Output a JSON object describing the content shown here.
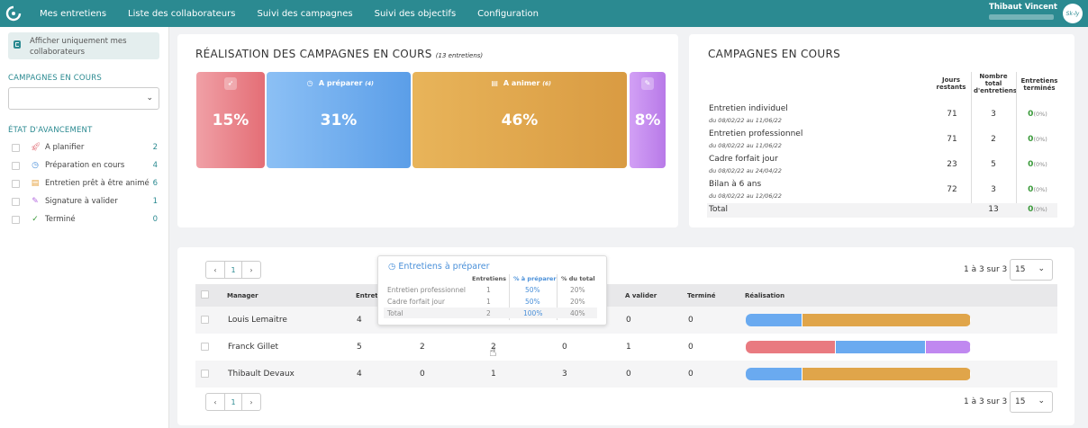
{
  "nav": {
    "items": [
      "Mes entretiens",
      "Liste des collaborateurs",
      "Suivi des campagnes",
      "Suivi des objectifs",
      "Configuration"
    ],
    "user_name": "Thibaut Vincent",
    "avatar_text": "Sk-ly"
  },
  "sidebar": {
    "toggle_label": "Afficher uniquement mes collaborateurs",
    "campaigns_title": "CAMPAGNES EN COURS",
    "progress_title": "ÉTAT D'AVANCEMENT",
    "statuses": [
      {
        "label": "A planifier",
        "count": "2",
        "icon": "rocket-icon",
        "color": "#e06b74"
      },
      {
        "label": "Préparation en cours",
        "count": "4",
        "icon": "clock-icon",
        "color": "#4a90d9"
      },
      {
        "label": "Entretien prêt à être animé",
        "count": "6",
        "icon": "document-icon",
        "color": "#e6a23c"
      },
      {
        "label": "Signature à valider",
        "count": "1",
        "icon": "edit-icon",
        "color": "#b56be0"
      },
      {
        "label": "Terminé",
        "count": "0",
        "icon": "check-icon",
        "color": "#3a9a3a"
      }
    ]
  },
  "realisation": {
    "title": "RÉALISATION DES CAMPAGNES EN COURS",
    "subtitle": "(13 entretiens)",
    "segments": [
      {
        "pct": "15%",
        "label": "",
        "badge": "",
        "icon": "rocket-icon",
        "color": "#e97a80",
        "fraction": 0.15
      },
      {
        "pct": "31%",
        "label": "A préparer",
        "badge": "(4)",
        "icon": "clock-icon",
        "color": "#6aaaf0",
        "fraction": 0.31
      },
      {
        "pct": "46%",
        "label": "A animer",
        "badge": "(6)",
        "icon": "document-icon",
        "color": "#e0a54a",
        "fraction": 0.46
      },
      {
        "pct": "8%",
        "label": "",
        "badge": "",
        "icon": "edit-icon",
        "color": "#c088f0",
        "fraction": 0.08
      }
    ]
  },
  "campaigns": {
    "title": "CAMPAGNES EN COURS",
    "headers": {
      "days": "Jours restants",
      "total": "Nombre total d'entretiens",
      "done": "Entretiens terminés"
    },
    "rows": [
      {
        "name": "Entretien individuel",
        "dates": "du 08/02/22 au 11/06/22",
        "days": "71",
        "total": "3",
        "done": "0",
        "done_pct": "(0%)"
      },
      {
        "name": "Entretien professionnel",
        "dates": "du 08/02/22 au 11/06/22",
        "days": "71",
        "total": "2",
        "done": "0",
        "done_pct": "(0%)"
      },
      {
        "name": "Cadre forfait jour",
        "dates": "du 08/02/22 au 24/04/22",
        "days": "23",
        "total": "5",
        "done": "0",
        "done_pct": "(0%)"
      },
      {
        "name": "Bilan à 6 ans",
        "dates": "du 08/02/22 au 12/06/22",
        "days": "72",
        "total": "3",
        "done": "0",
        "done_pct": "(0%)"
      }
    ],
    "total_row": {
      "label": "Total",
      "total": "13",
      "done": "0",
      "done_pct": "(0%)"
    }
  },
  "table": {
    "pager_prev": "‹",
    "pager_page": "1",
    "pager_next": "›",
    "range": "1 à 3 sur 3",
    "per_page": "15",
    "headers": {
      "manager": "Manager",
      "entretiens": "Entreti",
      "a_valider": "A valider",
      "termine": "Terminé",
      "realisation": "Réalisation"
    },
    "rows": [
      {
        "manager": "Louis Lemaitre",
        "entretiens": "4",
        "c2": "",
        "c3": "",
        "c4": "",
        "a_valider": "0",
        "termine": "0",
        "bar": [
          {
            "color": "#6aaaf0",
            "fraction": 0.25
          },
          {
            "color": "#e0a54a",
            "fraction": 0.75
          }
        ]
      },
      {
        "manager": "Franck Gillet",
        "entretiens": "5",
        "c2": "2",
        "c3": "2",
        "c4": "0",
        "a_valider": "1",
        "termine": "0",
        "bar": [
          {
            "color": "#e97a80",
            "fraction": 0.4
          },
          {
            "color": "#6aaaf0",
            "fraction": 0.4
          },
          {
            "color": "#c088f0",
            "fraction": 0.2
          }
        ]
      },
      {
        "manager": "Thibault Devaux",
        "entretiens": "4",
        "c2": "0",
        "c3": "1",
        "c4": "3",
        "a_valider": "0",
        "termine": "0",
        "bar": [
          {
            "color": "#6aaaf0",
            "fraction": 0.25
          },
          {
            "color": "#e0a54a",
            "fraction": 0.75
          }
        ]
      }
    ]
  },
  "tooltip": {
    "title": "Entretiens à préparer",
    "headers": {
      "count": "Entretiens",
      "pct": "% à préparer",
      "total": "% du total"
    },
    "rows": [
      {
        "label": "Entretien professionnel",
        "count": "1",
        "pct": "50%",
        "total": "20%"
      },
      {
        "label": "Cadre forfait jour",
        "count": "1",
        "pct": "50%",
        "total": "20%"
      },
      {
        "label": "Total",
        "count": "2",
        "pct": "100%",
        "total": "40%"
      }
    ]
  }
}
